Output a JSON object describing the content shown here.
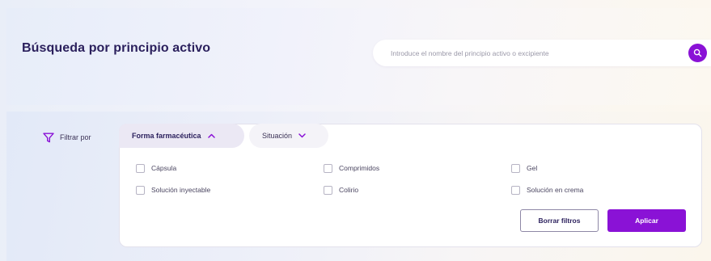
{
  "header": {
    "title": "Búsqueda por principio activo"
  },
  "search": {
    "placeholder": "Introduce el nombre del principio activo o excipiente",
    "value": "",
    "icon": "search-icon"
  },
  "filters": {
    "label": "Filtrar por",
    "label_icon": "funnel-icon",
    "tabs": [
      {
        "label": "Forma farmacéutica",
        "active": true,
        "icon": "chevron-up-icon"
      },
      {
        "label": "Situación",
        "active": false,
        "icon": "chevron-down-icon"
      }
    ],
    "options": [
      {
        "label": "Cápsula",
        "checked": false
      },
      {
        "label": "Comprimidos",
        "checked": false
      },
      {
        "label": "Gel",
        "checked": false
      },
      {
        "label": "Solución inyectable",
        "checked": false
      },
      {
        "label": "Colirio",
        "checked": false
      },
      {
        "label": "Solución en crema",
        "checked": false
      }
    ],
    "clear_label": "Borrar filtros",
    "apply_label": "Aplicar"
  },
  "colors": {
    "accent": "#8a12d6",
    "title": "#2a1f5c",
    "active_tab": "#ebe8f4"
  }
}
